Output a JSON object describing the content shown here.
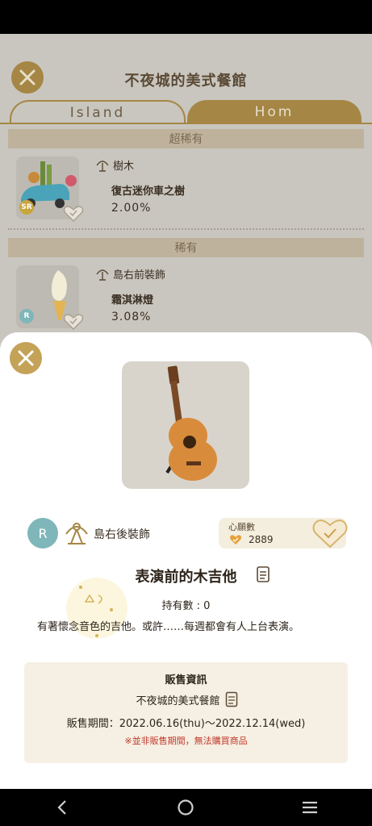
{
  "background": {
    "page_title": "不夜城的美式餐館",
    "tabs": [
      {
        "label": "Island"
      },
      {
        "label": "Hom"
      }
    ],
    "sections": [
      {
        "header": "超稀有",
        "item": {
          "category": "樹木",
          "name": "復古迷你車之樹",
          "percent": "2.00%",
          "rarity": "SR"
        }
      },
      {
        "header": "稀有",
        "item": {
          "category": "島右前裝飾",
          "name": "霜淇淋燈",
          "percent": "3.08%",
          "rarity": "R"
        }
      }
    ]
  },
  "modal": {
    "rarity": "R",
    "category": "島右後裝飾",
    "wish_label": "心願數",
    "wish_count": "2889",
    "title": "表演前的木吉他",
    "owned": "持有數 : 0",
    "description": "有著懷念音色的吉他。或許……每週都會有人上台表演。",
    "sale": {
      "title": "販售資訊",
      "shop": "不夜城的美式餐館",
      "period": "販售期間：2022.06.16(thu)〜2022.12.14(wed)",
      "note": "※並非販售期間，無法購買商品"
    }
  },
  "icons": {
    "close": "close-icon",
    "heart": "heart-icon",
    "document": "document-icon",
    "tree": "tree-category-icon",
    "back": "back-icon",
    "home": "home-icon",
    "recents": "recents-icon"
  },
  "colors": {
    "accent_gold": "#a58644",
    "modal_close": "#c4a258",
    "rarity_r": "#7fb6b9",
    "rarity_sr": "#c9a53c",
    "note_red": "#c0392b"
  }
}
